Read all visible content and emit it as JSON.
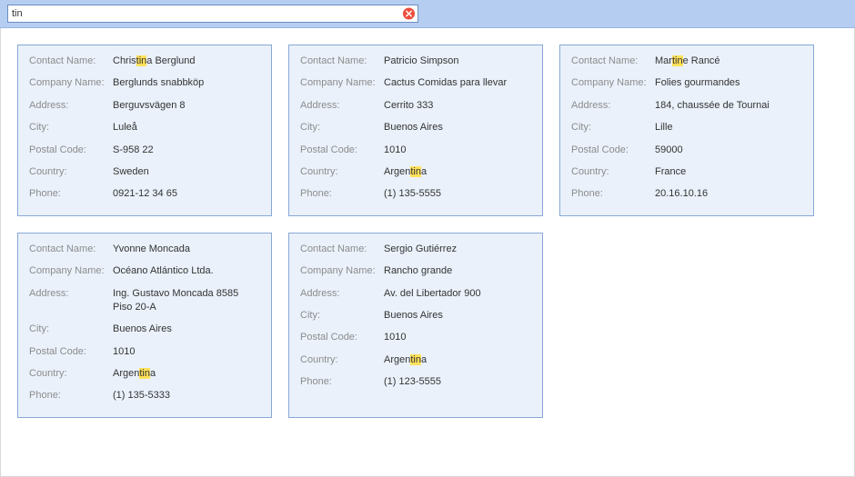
{
  "search": {
    "value": "tin",
    "placeholder": ""
  },
  "labels": {
    "contactName": "Contact Name:",
    "companyName": "Company Name:",
    "address": "Address:",
    "city": "City:",
    "postalCode": "Postal Code:",
    "country": "Country:",
    "phone": "Phone:"
  },
  "highlight": "tin",
  "results": [
    {
      "contactName": "Christina Berglund",
      "companyName": "Berglunds snabbköp",
      "address": "Berguvsvägen 8",
      "city": "Luleå",
      "postalCode": "S-958 22",
      "country": "Sweden",
      "phone": "0921-12 34 65"
    },
    {
      "contactName": "Patricio Simpson",
      "companyName": "Cactus Comidas para llevar",
      "address": "Cerrito 333",
      "city": "Buenos Aires",
      "postalCode": "1010",
      "country": "Argentina",
      "phone": "(1) 135-5555"
    },
    {
      "contactName": "Martine Rancé",
      "companyName": "Folies gourmandes",
      "address": "184, chaussée de Tournai",
      "city": "Lille",
      "postalCode": "59000",
      "country": "France",
      "phone": "20.16.10.16"
    },
    {
      "contactName": "Yvonne Moncada",
      "companyName": "Océano Atlántico Ltda.",
      "address": "Ing. Gustavo Moncada 8585 Piso 20-A",
      "city": "Buenos Aires",
      "postalCode": "1010",
      "country": "Argentina",
      "phone": "(1) 135-5333"
    },
    {
      "contactName": "Sergio Gutiérrez",
      "companyName": "Rancho grande",
      "address": "Av. del Libertador 900",
      "city": "Buenos Aires",
      "postalCode": "1010",
      "country": "Argentina",
      "phone": "(1) 123-5555"
    }
  ]
}
